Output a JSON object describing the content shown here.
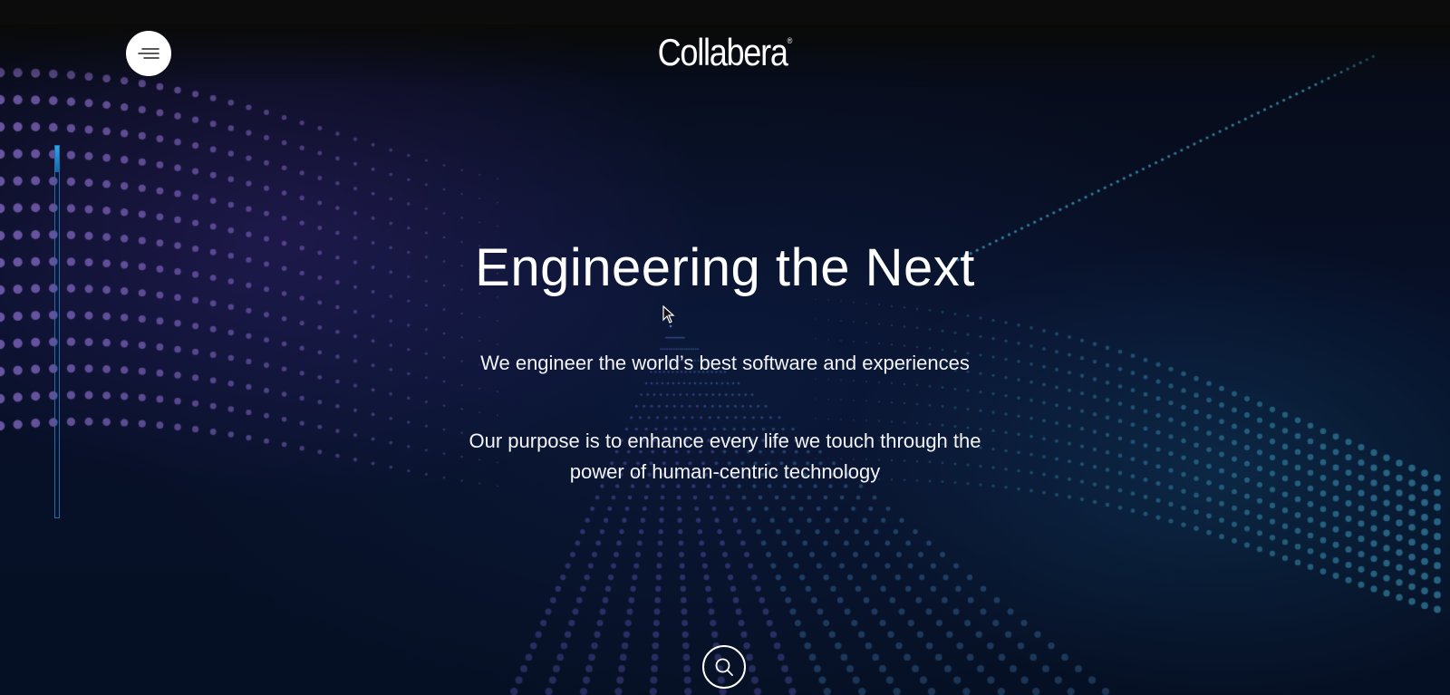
{
  "header": {
    "logo_text": "Collabera",
    "logo_mark": "®",
    "menu_icon": "hamburger-menu-icon"
  },
  "hero": {
    "title": "Engineering the Next",
    "subtitle": "We engineer the world’s best software and experiences",
    "purpose_line1": "Our purpose is to enhance every life we touch through the",
    "purpose_line2": "power of human-centric technology"
  },
  "scroll_progress": {
    "fraction": 0.07
  },
  "search": {
    "icon": "search-icon"
  },
  "colors": {
    "background": "#071028",
    "accent": "#2fa6e8",
    "text": "#ffffff",
    "particle_purple": "#b58cff",
    "particle_teal": "#4fc3e8"
  }
}
